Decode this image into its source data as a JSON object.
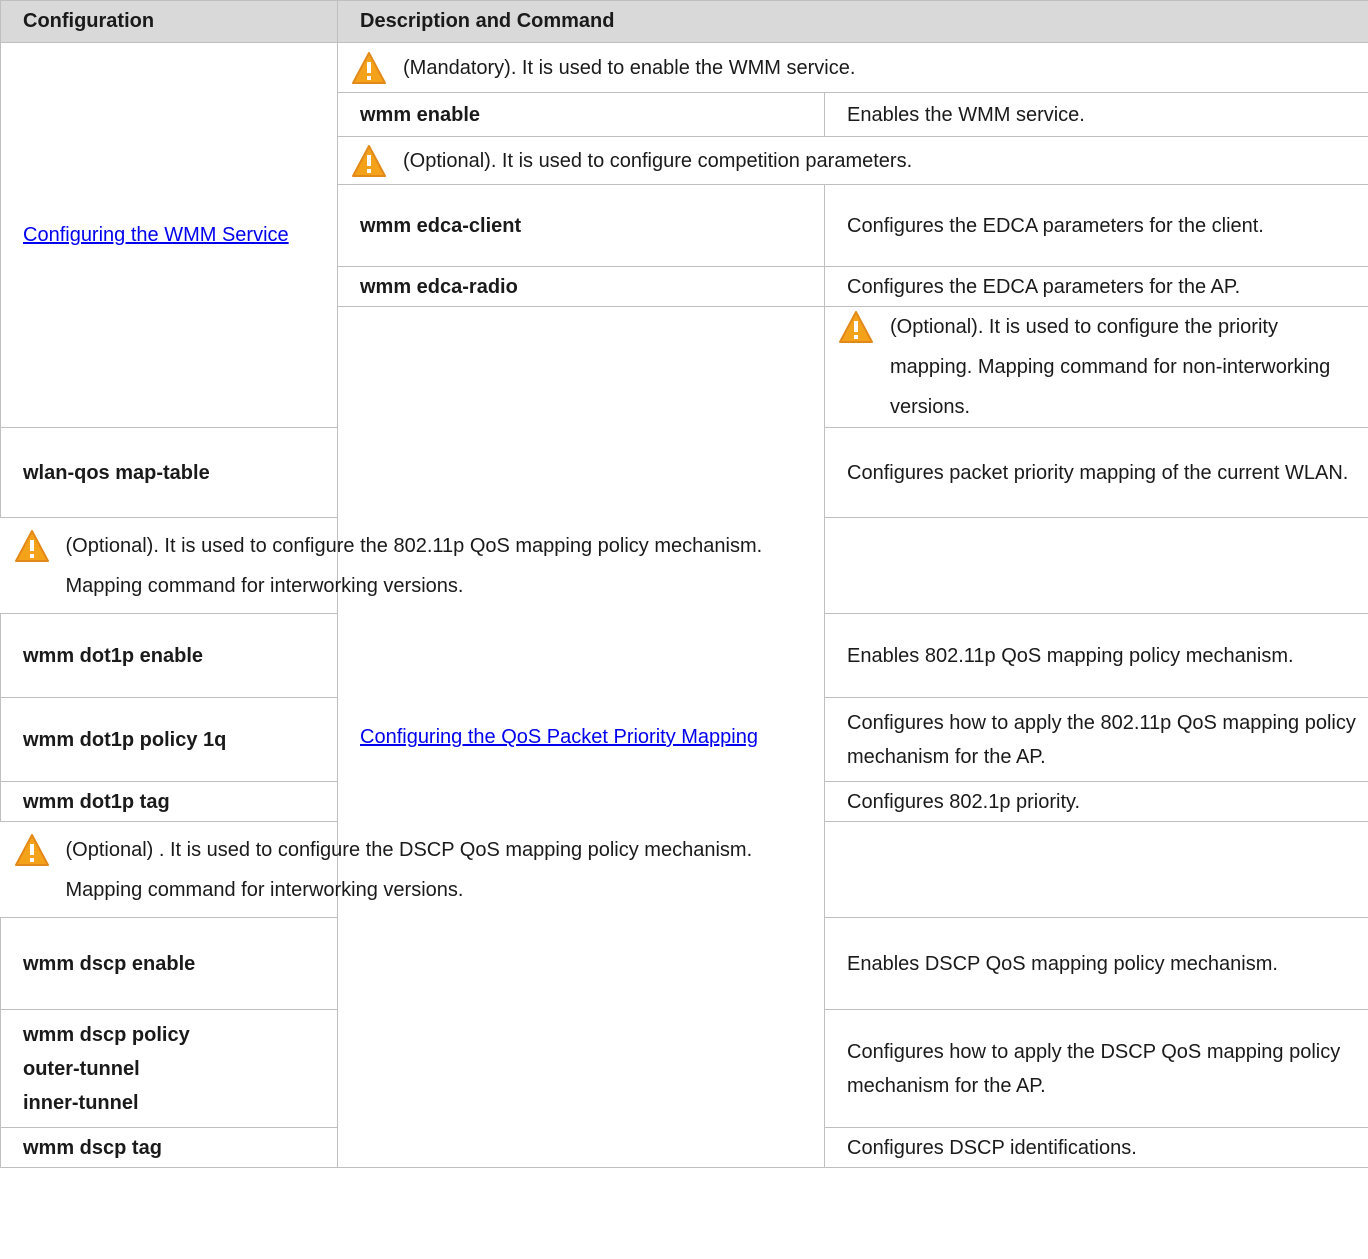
{
  "header": {
    "col1": "Configuration",
    "col2": "Description and Command"
  },
  "sections": {
    "wmm": {
      "link": "Configuring the WMM Service",
      "notice1": "(Mandatory). It is used to enable the WMM service.",
      "cmd1": "wmm enable",
      "desc1": "Enables the WMM service.",
      "notice2": "(Optional). It is used to configure competition parameters.",
      "cmd2": "wmm edca-client",
      "desc2": "Configures the EDCA parameters for the client.",
      "cmd3": "wmm edca-radio",
      "desc3": "Configures the EDCA parameters for the AP."
    },
    "qos": {
      "link": "Configuring the QoS Packet Priority Mapping",
      "notice1": "(Optional). It is used to configure the priority mapping. Mapping command for non-interworking versions.",
      "cmd1": "wlan-qos map-table",
      "desc1": "Configures packet priority mapping of the current WLAN.",
      "notice2": "(Optional). It is used to configure the 802.11p QoS mapping policy mechanism. Mapping command for interworking versions.",
      "cmd2": "wmm dot1p enable",
      "desc2": "Enables 802.11p QoS mapping policy mechanism.",
      "cmd3": "wmm dot1p policy 1q",
      "desc3": "Configures how to apply the 802.11p QoS mapping policy mechanism for the AP.",
      "cmd4": "wmm dot1p tag",
      "desc4": "Configures 802.1p priority.",
      "notice3": "(Optional) . It is used to configure the DSCP QoS mapping policy mechanism. Mapping command for interworking versions.",
      "cmd5": "wmm dscp enable",
      "desc5": "Enables DSCP QoS mapping policy mechanism.",
      "cmd6_line1": "wmm dscp policy",
      "cmd6_line2": "outer-tunnel",
      "cmd6_line3": "inner-tunnel",
      "desc6": "Configures how to apply the DSCP QoS mapping policy mechanism for the AP.",
      "cmd7": "wmm dscp tag",
      "desc7": "Configures DSCP identifications."
    }
  }
}
